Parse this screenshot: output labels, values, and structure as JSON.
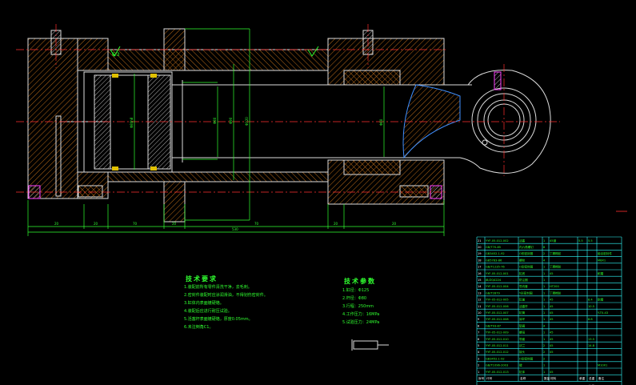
{
  "drawing": {
    "dimensions": {
      "overall_length": "530",
      "seg_1": "20",
      "seg_2": "20",
      "seg_3": "70",
      "seg_4": "20",
      "seg_5": "70",
      "seg_6": "20",
      "seg_7": "20",
      "dia_piston": "Φ80h8",
      "dia_rod": "Φ80",
      "dia_bore": "Φ90",
      "dia_outer": "Φ120",
      "dia_port": "Φ60"
    },
    "roughness_label": "6.3"
  },
  "technical_requirements": {
    "title": "技术要求",
    "lines": [
      "1.装配前所有零件清洗干净，去毛刺。",
      "2.密封件装配时应涂润滑油，不得划伤密封件。",
      "3.缸体内表面镀硬铬。",
      "4.装配后应进行耐压试验。",
      "5.活塞杆表面镀硬铬，厚度0.05mm。",
      "6.未注倒角C1。"
    ]
  },
  "technical_params": {
    "title": "技术参数",
    "lines": [
      "1.缸径：Φ125",
      "2.杆径：Φ80",
      "3.行程：250mm",
      "4.工作压力：16MPa",
      "5.试验压力：24MPa"
    ]
  },
  "bom": {
    "rows": [
      [
        "21",
        "YYF-05-012-002",
        "活塞",
        "1",
        "45钢",
        "5.5",
        "5.5",
        ""
      ],
      [
        "20",
        "GB/T70-85",
        "内六角螺钉",
        "8",
        "",
        "",
        "",
        ""
      ],
      [
        "19",
        "GB3452.1-92",
        "O形密封圈",
        "2",
        "丁腈橡胶",
        "",
        "",
        "组合密封件"
      ],
      [
        "18",
        "GB5783-86",
        "螺栓",
        "4",
        "",
        "",
        "",
        "M8X1"
      ],
      [
        "17",
        "GB/T1235-76",
        "O形密封圈",
        "1",
        "丁腈橡胶",
        "",
        "",
        ""
      ],
      [
        "16",
        "YYF-05-012-001",
        "缸底",
        "1",
        "45",
        "",
        "",
        "耐磨"
      ],
      [
        "15",
        "JB/ZQ4224",
        "防尘圈",
        "1",
        "",
        "",
        "",
        ""
      ],
      [
        "14",
        "YYF-05-012-004",
        "导向套",
        "1",
        "HT200",
        "",
        "",
        ""
      ],
      [
        "13",
        "GB/T2879",
        "Y形密封圈",
        "1",
        "丁腈橡胶",
        "",
        "",
        ""
      ],
      [
        "12",
        "YYF-05-012-005",
        "缸盖",
        "1",
        "45",
        "",
        "8.4",
        "耐磨"
      ],
      [
        "11",
        "YYF-05-012-006",
        "活塞杆",
        "1",
        "45",
        "",
        "10.5",
        ""
      ],
      [
        "10",
        "YYF-05-012-007",
        "缸筒",
        "1",
        "45",
        "",
        "",
        "Y-T0-43"
      ],
      [
        "9",
        "YYF-05-012-008",
        "耳环",
        "1",
        "45",
        "",
        "8.8",
        ""
      ],
      [
        "8",
        "GB/T93-87",
        "垫圈",
        "4",
        "",
        "",
        "",
        ""
      ],
      [
        "7",
        "YYF-05-012-009",
        "螺母",
        "1",
        "45",
        "",
        "",
        ""
      ],
      [
        "6",
        "YYF-05-012-010",
        "导套",
        "1",
        "45",
        "",
        "13.5",
        ""
      ],
      [
        "5",
        "YYF-05-012-011",
        "法兰",
        "2",
        "45",
        "",
        "14.8",
        ""
      ],
      [
        "4",
        "YYF-05-012-012",
        "接头",
        "2",
        "45",
        "",
        "",
        ""
      ],
      [
        "3",
        "GB3452.1-92",
        "O形密封圈",
        "2",
        "",
        "",
        "",
        ""
      ],
      [
        "2",
        "GB/T1096-2003",
        "键",
        "1",
        "",
        "",
        "",
        "M10X1"
      ],
      [
        "1",
        "YYF-05-012-013",
        "缸体",
        "1",
        "45",
        "",
        "",
        ""
      ]
    ],
    "header": [
      "序号",
      "代号",
      "名称",
      "数量",
      "材料",
      "单重",
      "总重",
      "备注"
    ],
    "footer_right": "比例"
  }
}
